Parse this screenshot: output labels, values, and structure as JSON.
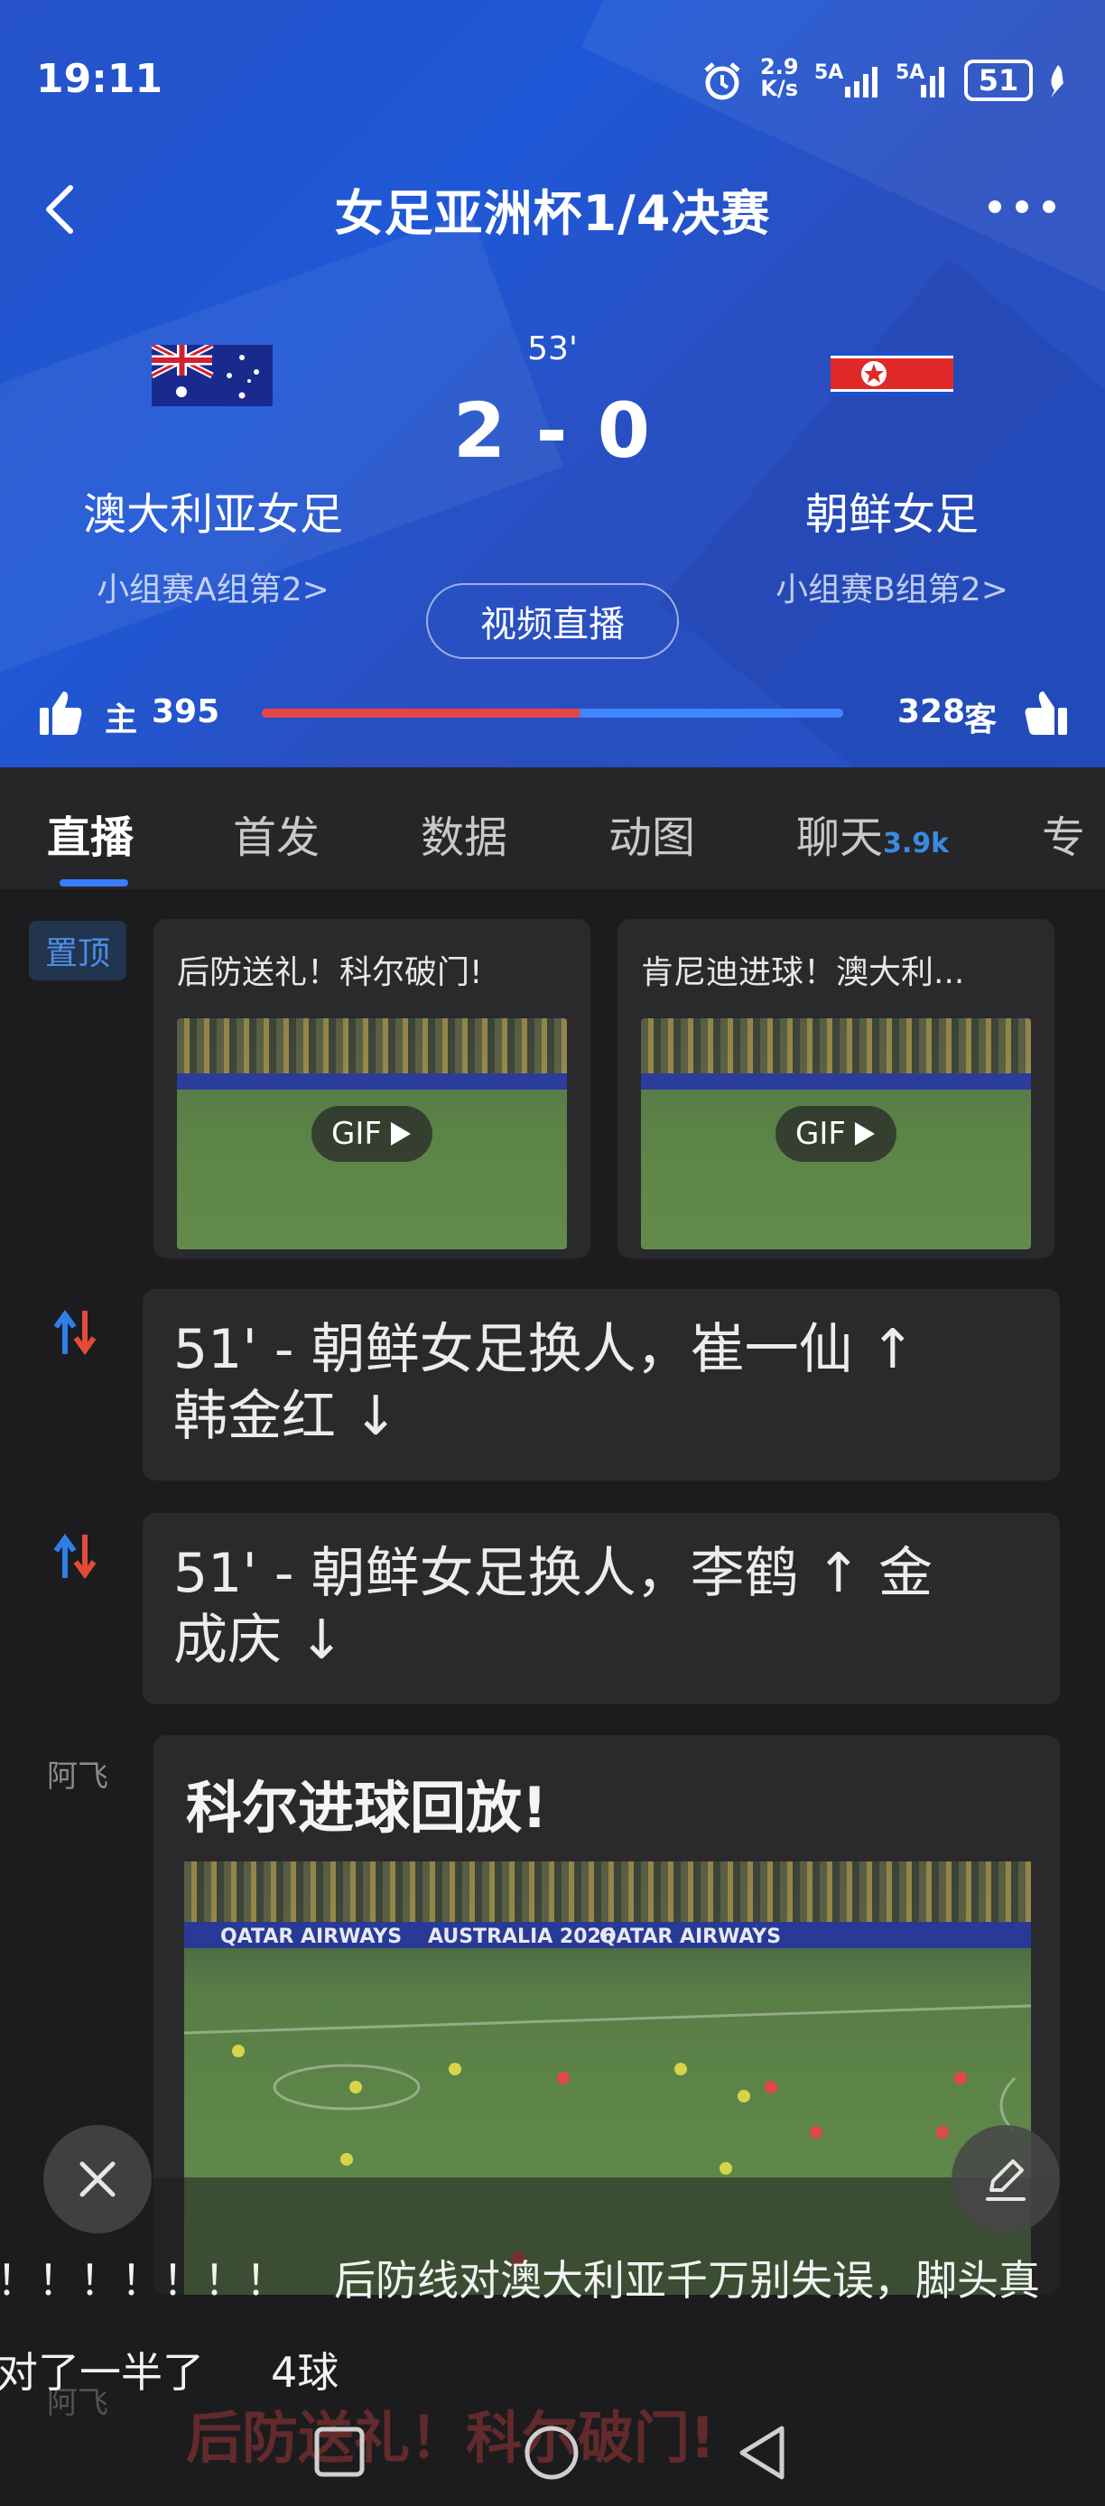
{
  "status_bar": {
    "time": "19:11",
    "net_speed_top": "2.9",
    "net_speed_unit": "K/s",
    "sim1": "5A",
    "sim2": "5A",
    "battery": "51"
  },
  "header": {
    "title": "女足亚洲杯1/4决赛",
    "minute": "53'",
    "score": "2 - 0",
    "home_team": "澳大利亚女足",
    "home_group": "小组赛A组第2>",
    "away_team": "朝鲜女足",
    "away_group": "小组赛B组第2>",
    "video_button": "视频直播",
    "home_label": "主",
    "home_votes": "395",
    "away_votes": "328",
    "away_label": "客",
    "home_vote_share": 0.546
  },
  "tabs": [
    {
      "label": "直播"
    },
    {
      "label": "首发"
    },
    {
      "label": "数据"
    },
    {
      "label": "动图"
    },
    {
      "label": "聊天",
      "badge": "3.9k"
    },
    {
      "label": "专"
    }
  ],
  "feed": {
    "pin_label": "置顶",
    "gif_cards": [
      {
        "title": "后防送礼！科尔破门!",
        "gif_label": "GIF"
      },
      {
        "title": "肯尼迪进球！澳大利...",
        "gif_label": "GIF"
      }
    ],
    "events": [
      {
        "text_line1": "51' - 朝鲜女足换人，崔一仙 ↑",
        "text_line2": "韩金红 ↓"
      },
      {
        "text_line1": "51' - 朝鲜女足换人，李鹤 ↑ 金",
        "text_line2": "成庆 ↓"
      }
    ],
    "post": {
      "author": "阿飞",
      "title": "科尔进球回放!",
      "banner_text_1": "QATAR AIRWAYS",
      "banner_text_2": "AUSTRALIA 2026",
      "banner_text_3": "QATAR AIRWAYS"
    },
    "ghost_author": "阿飞",
    "ghost_title": "后防送礼！科尔破门!"
  },
  "danmaku": {
    "line1_a": "！！！！！！！",
    "line1_b": "后防线对澳大利亚千万别失误，脚头真",
    "line2_a": "对了一半了",
    "line2_b": "4球"
  },
  "colors": {
    "header_blue": "#2552c8",
    "accent_blue": "#3a7bff",
    "home_red": "#e64545"
  },
  "icons": [
    "back-arrow-icon",
    "more-icon",
    "thumb-up-icon",
    "substitution-icon",
    "close-icon",
    "edit-icon",
    "play-icon"
  ]
}
